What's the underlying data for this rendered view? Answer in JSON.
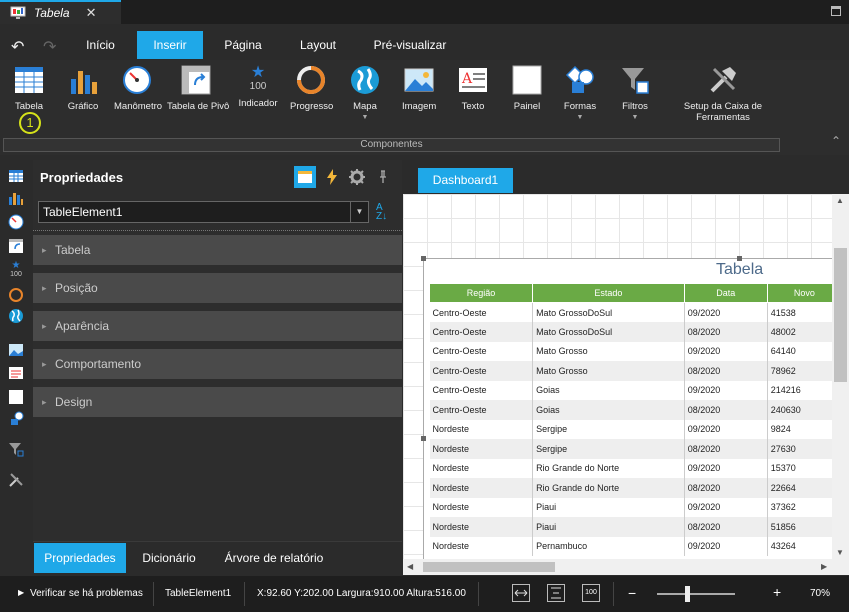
{
  "window": {
    "tab_title": "Tabela",
    "close_glyph": "✕"
  },
  "menu": {
    "undo": "↶",
    "redo": "↷",
    "items": [
      "Início",
      "Inserir",
      "Página",
      "Layout",
      "Pré-visualizar"
    ],
    "active": "Inserir"
  },
  "ribbon": {
    "buttons": [
      {
        "label": "Tabela",
        "icon": "table-icon"
      },
      {
        "label": "Gráfico",
        "icon": "bar-chart-icon"
      },
      {
        "label": "Manômetro",
        "icon": "gauge-icon"
      },
      {
        "label": "Tabela de Pivô",
        "icon": "pivot-table-icon"
      },
      {
        "label": "Indicador",
        "icon": "indicator-icon",
        "value": "100"
      },
      {
        "label": "Progresso",
        "icon": "progress-ring-icon"
      },
      {
        "label": "Mapa",
        "icon": "globe-icon"
      },
      {
        "label": "Imagem",
        "icon": "image-icon"
      },
      {
        "label": "Texto",
        "icon": "text-icon"
      },
      {
        "label": "Painel",
        "icon": "panel-icon"
      },
      {
        "label": "Formas",
        "icon": "shapes-icon"
      },
      {
        "label": "Filtros",
        "icon": "filter-icon"
      },
      {
        "label": "Setup da Caixa de Ferramentas",
        "icon": "tools-icon"
      }
    ],
    "badge": "1",
    "group_label": "Componentes"
  },
  "properties": {
    "title": "Propriedades",
    "selected_element": "TableElement1",
    "categories": [
      "Tabela",
      "Posição",
      "Aparência",
      "Comportamento",
      "Design"
    ],
    "bottom_tabs": [
      "Propriedades",
      "Dicionário",
      "Árvore de relatório"
    ]
  },
  "dashboard": {
    "tab": "Dashboard1",
    "table": {
      "title": "Tabela",
      "columns": [
        "Região",
        "Estado",
        "Data",
        "Novo"
      ],
      "rows": [
        [
          "Centro-Oeste",
          "Mato GrossoDoSul",
          "09/2020",
          "41538"
        ],
        [
          "Centro-Oeste",
          "Mato GrossoDoSul",
          "08/2020",
          "48002"
        ],
        [
          "Centro-Oeste",
          "Mato Grosso",
          "09/2020",
          "64140"
        ],
        [
          "Centro-Oeste",
          "Mato Grosso",
          "08/2020",
          "78962"
        ],
        [
          "Centro-Oeste",
          "Goias",
          "09/2020",
          "214216"
        ],
        [
          "Centro-Oeste",
          "Goias",
          "08/2020",
          "240630"
        ],
        [
          "Nordeste",
          "Sergipe",
          "09/2020",
          "9824"
        ],
        [
          "Nordeste",
          "Sergipe",
          "08/2020",
          "27630"
        ],
        [
          "Nordeste",
          "Rio Grande do Norte",
          "09/2020",
          "15370"
        ],
        [
          "Nordeste",
          "Rio Grande do Norte",
          "08/2020",
          "22664"
        ],
        [
          "Nordeste",
          "Piaui",
          "09/2020",
          "37362"
        ],
        [
          "Nordeste",
          "Piaui",
          "08/2020",
          "51856"
        ],
        [
          "Nordeste",
          "Pernambuco",
          "09/2020",
          "43264"
        ]
      ]
    }
  },
  "status": {
    "check": "Verificar se há problemas",
    "element": "TableElement1",
    "geometry": "X:92.60 Y:202.00 Largura:910.00 Altura:516.00",
    "zoom": "70%",
    "zoom_out": "−",
    "zoom_in": "+",
    "zoom_slider_fraction": 0.38,
    "button_100": "100"
  },
  "colors": {
    "accent": "#1fa8e8",
    "table_header": "#6aaa45",
    "badge": "#d6e21a"
  }
}
